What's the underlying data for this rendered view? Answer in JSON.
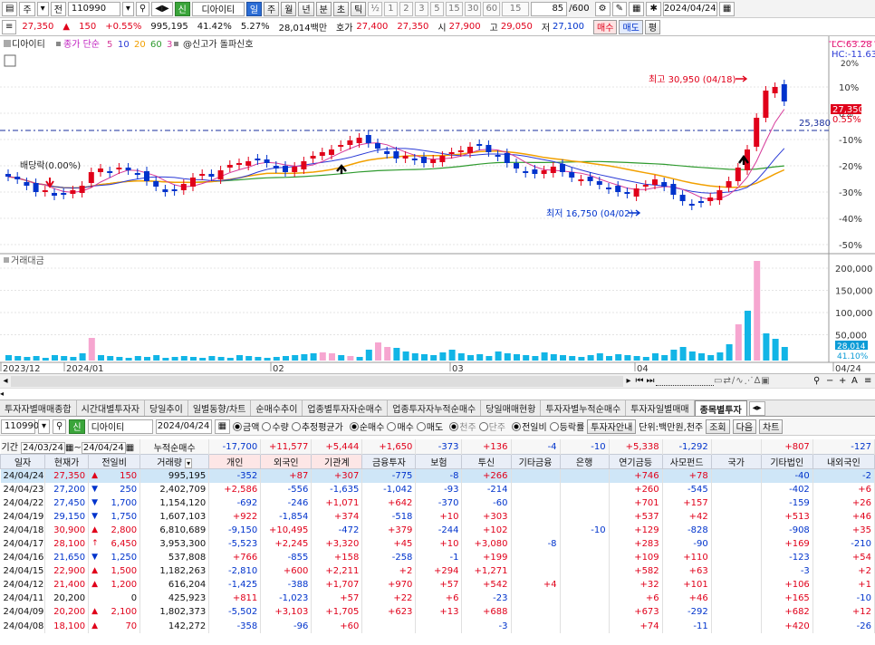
{
  "toolbar": {
    "market": "주",
    "type": "전",
    "code": "110990",
    "name": "디아이티",
    "periods": [
      "일",
      "주",
      "월",
      "년",
      "분",
      "초",
      "틱"
    ],
    "fraction": "½",
    "counts": [
      "1",
      "2",
      "3",
      "5",
      "15",
      "30",
      "60"
    ],
    "count_sel": "15",
    "bars": "85",
    "bars_total": "/600",
    "date": "2024/04/24"
  },
  "quote": {
    "price": "27,350",
    "change": "150",
    "pct": "+0.55%",
    "volume": "995,195",
    "rate1": "41.42%",
    "rate2": "5.27%",
    "amount": "28,014백만",
    "hoga_label": "호가",
    "ask": "27,400",
    "bid": "27,350",
    "open_label": "시",
    "open": "27,900",
    "high_label": "고",
    "high": "29,050",
    "low_label": "저",
    "low": "27,100",
    "buy": "매수",
    "sell": "매도",
    "avg": "평"
  },
  "chart": {
    "legend_name": "디아이티",
    "legend_ma": "종가 단순",
    "ma": [
      "5",
      "10",
      "20",
      "60",
      "3"
    ],
    "signal": "@신고가 돌파신호",
    "lc": "LC:63.28",
    "hc": "HC:-11.63",
    "hi_label": "최고 30,950 (04/18)",
    "lo_label": "최저 16,750 (04/02)",
    "div_label": "배당락(0.00%)",
    "price_tag": "27,350",
    "price_pct": "0.55%",
    "level": "25,380",
    "y_labels": [
      "10%",
      "0%",
      "-10%",
      "-20%",
      "-30%",
      "-40%",
      "-50%"
    ],
    "y_top": "20%",
    "vol_title": "거래대금",
    "vol_labels": [
      "200,000",
      "150,000",
      "100,000",
      "50,000"
    ],
    "vol_tag1": "28,014",
    "vol_tag2": "41.10%",
    "x_labels": [
      "2023/12",
      "2024/01",
      "02",
      "03",
      "04",
      "04/24"
    ]
  },
  "chart_data": {
    "type": "candlestick",
    "title": "디아이티",
    "ylabel": "%",
    "series": [
      "종가 단순 5",
      "10",
      "20",
      "60",
      "3"
    ],
    "highlights": {
      "high": 30950,
      "high_date": "04/18",
      "low": 16750,
      "low_date": "04/02",
      "last": 27350,
      "level": 25380
    }
  },
  "tabs": [
    "투자자별매매종합",
    "시간대별투자자",
    "당일추이",
    "일별동향/차트",
    "순매수추이",
    "업종별투자자순매수",
    "업종투자자누적순매수",
    "당일매매현황",
    "투자자별누적순매수",
    "투자자일별매매",
    "종목별투자"
  ],
  "filter": {
    "code": "110990",
    "name": "디아이티",
    "date": "2024/04/24",
    "r1": [
      "금액",
      "수량",
      "추정평균가"
    ],
    "r2": [
      "순매수",
      "매수",
      "매도"
    ],
    "r3": [
      "천주",
      "단주"
    ],
    "r4": [
      "전일비",
      "등락률"
    ],
    "guide": "투자자안내",
    "unit": "단위:백만원,천주",
    "search": "조회",
    "next": "다음",
    "chart": "차트"
  },
  "period": {
    "label": "기간",
    "from": "24/03/24",
    "to": "24/04/24",
    "cum": "누적순매수",
    "sums": [
      "-17,700",
      "+11,577",
      "+5,444",
      "+1,650",
      "-373",
      "+136",
      "-4",
      "-10",
      "+5,338",
      "-1,292",
      "",
      "+807",
      "-127"
    ]
  },
  "headers": [
    "일자",
    "현재가",
    "전일비",
    "거래량",
    "개인",
    "외국인",
    "기관계",
    "금융투자",
    "보험",
    "투신",
    "기타금융",
    "은행",
    "연기금등",
    "사모펀드",
    "국가",
    "기타법인",
    "내외국인"
  ],
  "rows": [
    [
      "24/04/24",
      "27,350",
      "▲",
      "150",
      "995,195",
      "-352",
      "+87",
      "+307",
      "-775",
      "-8",
      "+266",
      "",
      "",
      "+746",
      "+78",
      "",
      "-40",
      "-2"
    ],
    [
      "24/04/23",
      "27,200",
      "▼",
      "250",
      "2,402,709",
      "+2,586",
      "-556",
      "-1,635",
      "-1,042",
      "-93",
      "-214",
      "",
      "",
      "+260",
      "-545",
      "",
      "-402",
      "+6"
    ],
    [
      "24/04/22",
      "27,450",
      "▼",
      "1,700",
      "1,154,120",
      "-692",
      "-246",
      "+1,071",
      "+642",
      "-370",
      "-60",
      "",
      "",
      "+701",
      "+157",
      "",
      "-159",
      "+26"
    ],
    [
      "24/04/19",
      "29,150",
      "▼",
      "1,750",
      "1,607,103",
      "+922",
      "-1,854",
      "+374",
      "-518",
      "+10",
      "+303",
      "",
      "",
      "+537",
      "+42",
      "",
      "+513",
      "+46"
    ],
    [
      "24/04/18",
      "30,900",
      "▲",
      "2,800",
      "6,810,689",
      "-9,150",
      "+10,495",
      "-472",
      "+379",
      "-244",
      "+102",
      "",
      "-10",
      "+129",
      "-828",
      "",
      "-908",
      "+35"
    ],
    [
      "24/04/17",
      "28,100",
      "↑",
      "6,450",
      "3,953,300",
      "-5,523",
      "+2,245",
      "+3,320",
      "+45",
      "+10",
      "+3,080",
      "-8",
      "",
      "+283",
      "-90",
      "",
      "+169",
      "-210"
    ],
    [
      "24/04/16",
      "21,650",
      "▼",
      "1,250",
      "537,808",
      "+766",
      "-855",
      "+158",
      "-258",
      "-1",
      "+199",
      "",
      "",
      "+109",
      "+110",
      "",
      "-123",
      "+54"
    ],
    [
      "24/04/15",
      "22,900",
      "▲",
      "1,500",
      "1,182,263",
      "-2,810",
      "+600",
      "+2,211",
      "+2",
      "+294",
      "+1,271",
      "",
      "",
      "+582",
      "+63",
      "",
      "-3",
      "+2"
    ],
    [
      "24/04/12",
      "21,400",
      "▲",
      "1,200",
      "616,204",
      "-1,425",
      "-388",
      "+1,707",
      "+970",
      "+57",
      "+542",
      "+4",
      "",
      "+32",
      "+101",
      "",
      "+106",
      "+1"
    ],
    [
      "24/04/11",
      "20,200",
      "",
      "0",
      "425,923",
      "+811",
      "-1,023",
      "+57",
      "+22",
      "+6",
      "-23",
      "",
      "",
      "+6",
      "+46",
      "",
      "+165",
      "-10"
    ],
    [
      "24/04/09",
      "20,200",
      "▲",
      "2,100",
      "1,802,373",
      "-5,502",
      "+3,103",
      "+1,705",
      "+623",
      "+13",
      "+688",
      "",
      "",
      "+673",
      "-292",
      "",
      "+682",
      "+12"
    ],
    [
      "24/04/08",
      "18,100",
      "▲",
      "70",
      "142,272",
      "-358",
      "-96",
      "+60",
      "",
      "",
      "-3",
      "",
      "",
      "+74",
      "-11",
      "",
      "+420",
      "-26"
    ]
  ]
}
